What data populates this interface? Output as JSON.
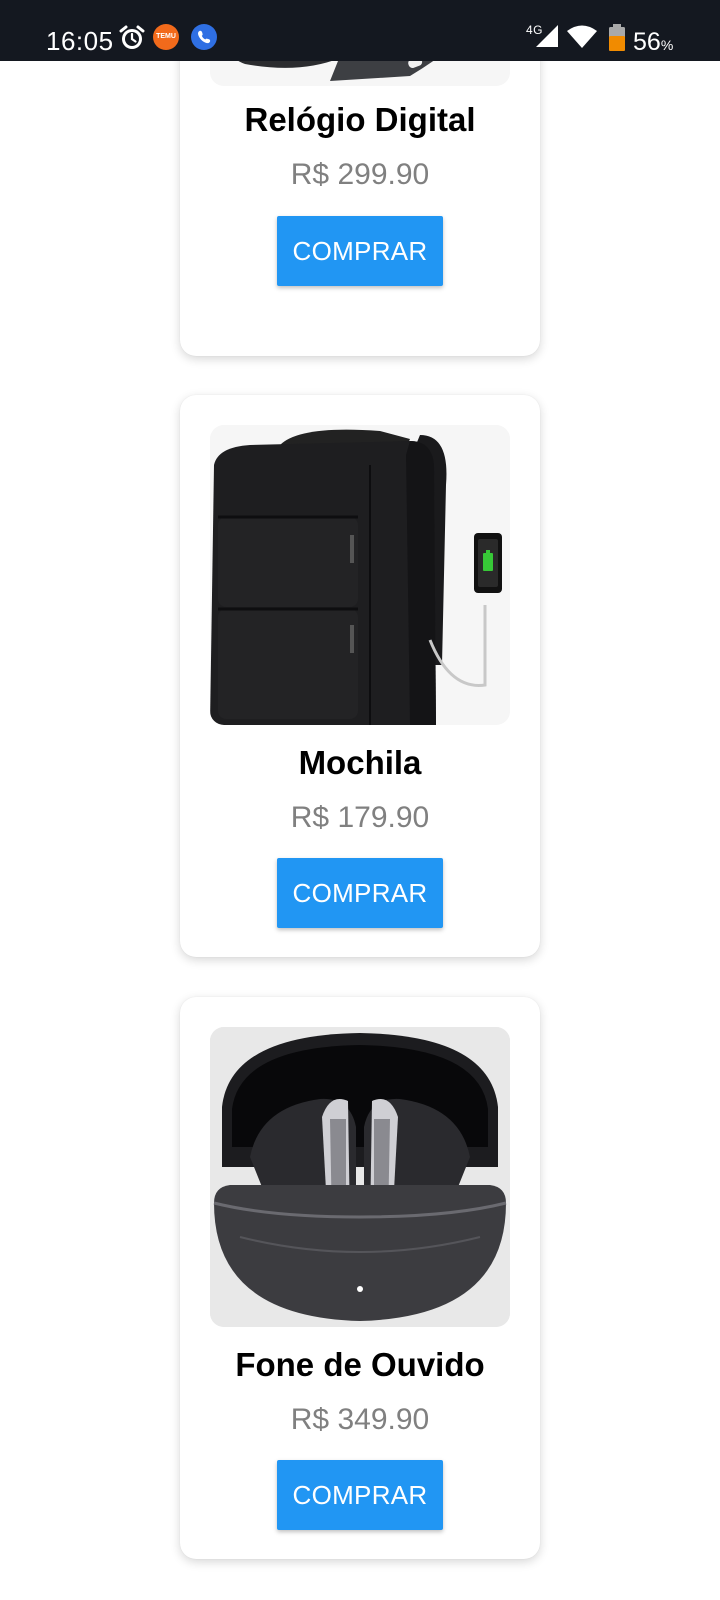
{
  "status_bar": {
    "time": "16:05",
    "network": "4G",
    "battery": "56",
    "battery_unit": "%",
    "icons": [
      "alarm-icon",
      "temu-app-icon",
      "phone-call-icon",
      "signal-icon",
      "wifi-icon",
      "battery-icon"
    ]
  },
  "theme": {
    "button_color": "#2196f3",
    "price_color": "#808080",
    "status_bar_color": "#141820"
  },
  "products": [
    {
      "name": "Relógio Digital",
      "price": "R$ 299.90",
      "button_label": "COMPRAR",
      "image": "smartwatch-image"
    },
    {
      "name": "Mochila",
      "price": "R$ 179.90",
      "button_label": "COMPRAR",
      "image": "backpack-image"
    },
    {
      "name": "Fone de Ouvido",
      "price": "R$ 349.90",
      "button_label": "COMPRAR",
      "image": "earbuds-image"
    }
  ]
}
